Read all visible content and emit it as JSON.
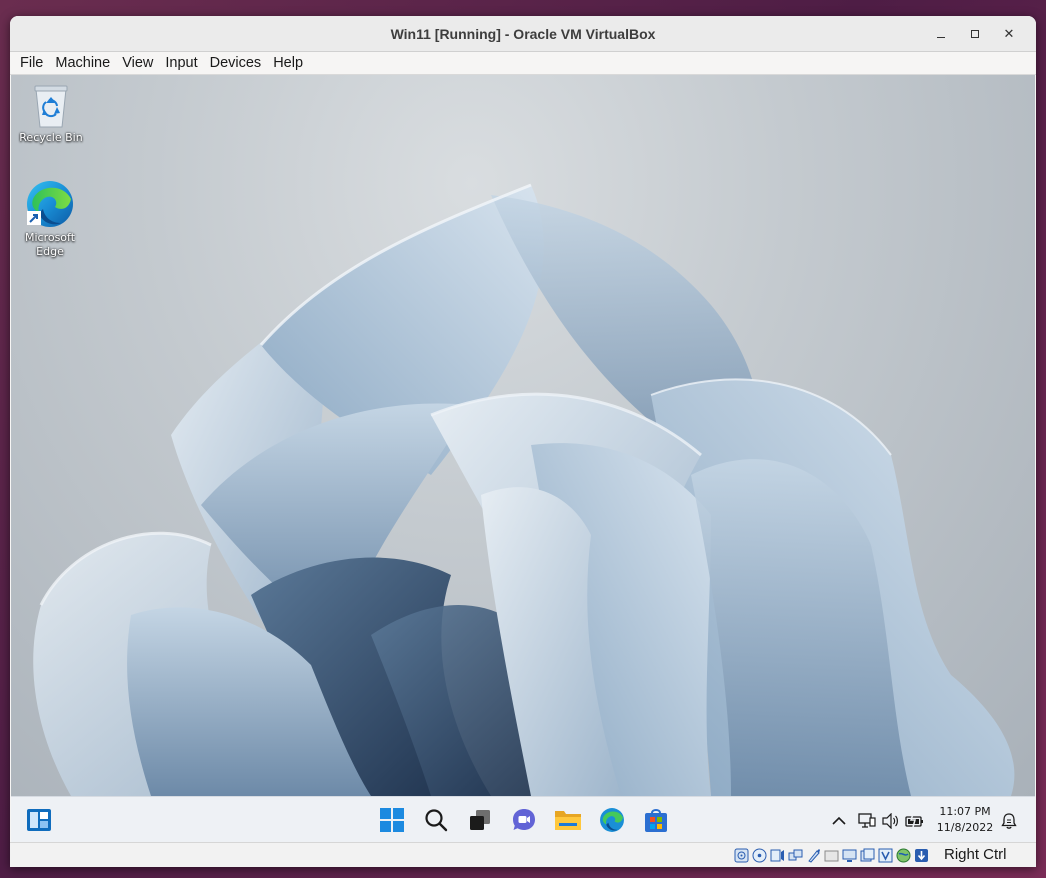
{
  "window": {
    "title": "Win11 [Running] - Oracle VM VirtualBox"
  },
  "menubar": {
    "items": [
      "File",
      "Machine",
      "View",
      "Input",
      "Devices",
      "Help"
    ]
  },
  "desktop": {
    "icons": [
      {
        "label": "Recycle Bin",
        "icon": "recycle-bin-icon"
      },
      {
        "label": "Microsoft Edge",
        "icon": "edge-icon"
      }
    ]
  },
  "taskbar": {
    "apps": [
      "widgets-icon",
      "start-icon",
      "search-icon",
      "task-view-icon",
      "chat-icon",
      "file-explorer-icon",
      "edge-icon",
      "store-icon"
    ],
    "tray": [
      "chevron-up-icon",
      "network-icon",
      "volume-icon",
      "battery-icon",
      "notification-icon"
    ],
    "clock": {
      "time": "11:07 PM",
      "date": "11/8/2022"
    }
  },
  "statusbar": {
    "icons": [
      "hard-disk-icon",
      "optical-drive-icon",
      "audio-icon",
      "network-adapter-icon",
      "usb-icon",
      "shared-folders-icon",
      "display-icon",
      "recording-icon",
      "virtualization-icon",
      "mouse-integration-icon",
      "keyboard-icon"
    ],
    "host_key": "Right Ctrl"
  },
  "colors": {
    "accent": "#0067c0",
    "wallpaper_base": "#c4cacf",
    "ubuntu_background": "#5e2750"
  }
}
